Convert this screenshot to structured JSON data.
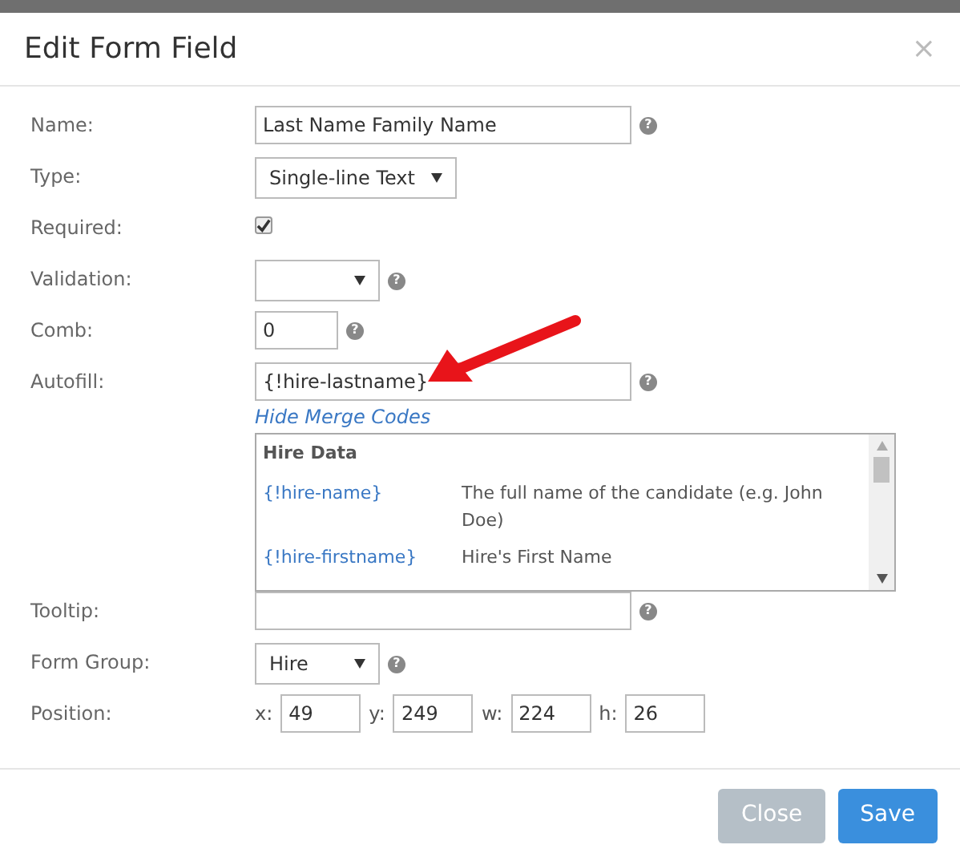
{
  "dialog": {
    "title": "Edit Form Field",
    "close": "×"
  },
  "fields": [
    {
      "kind": "text",
      "label": "Name:",
      "value": "Last Name Family Name",
      "help": "?"
    },
    {
      "kind": "select",
      "label": "Type:",
      "value": "Single-line Text"
    },
    {
      "kind": "checkbox",
      "label": "Required:",
      "checked": true
    },
    {
      "kind": "select",
      "label": "Validation:",
      "help": "?"
    },
    {
      "kind": "number",
      "label": "Comb:",
      "value": "0",
      "help": "?"
    },
    {
      "kind": "text",
      "label": "Autofill:",
      "value": "{!hire-lastname}",
      "help": "?",
      "annotated": true,
      "merge_codes": {
        "link": "Hide Merge Codes",
        "heading": "Hire Data",
        "rows": [
          {
            "code": "{!hire-name}",
            "description": "The full name of the candidate (e.g. John Doe)"
          },
          {
            "code": "{!hire-firstname}",
            "description": "Hire's First Name"
          }
        ]
      }
    },
    {
      "kind": "text",
      "label": "Tooltip:",
      "help": "?"
    },
    {
      "kind": "select",
      "label": "Form Group:",
      "value": "Hire",
      "help": "?"
    },
    {
      "kind": "position",
      "label": "Position:",
      "parts": [
        {
          "label": "x:",
          "value": "49"
        },
        {
          "label": "y:",
          "value": "249"
        },
        {
          "label": "w:",
          "value": "224"
        },
        {
          "label": "h:",
          "value": "26"
        }
      ]
    }
  ],
  "buttons": [
    {
      "label": "Close",
      "kind": "secondary"
    },
    {
      "label": "Save",
      "kind": "primary"
    }
  ]
}
